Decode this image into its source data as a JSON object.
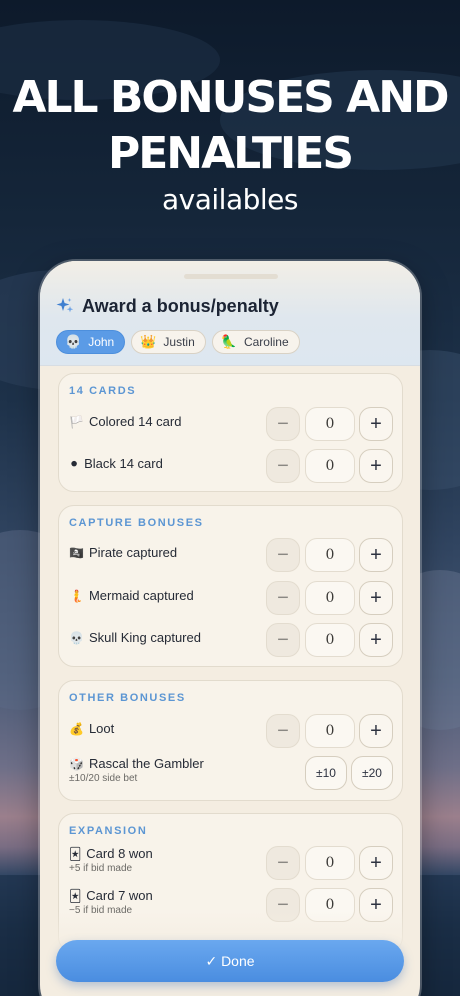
{
  "promo": {
    "headline_line1": "ALL BONUSES AND",
    "headline_line2": "PENALTIES",
    "subtitle": "availables"
  },
  "sheet": {
    "title": "Award a bonus/penalty",
    "players": [
      {
        "emoji": "💀",
        "name": "John",
        "selected": true
      },
      {
        "emoji": "👑",
        "name": "Justin",
        "selected": false
      },
      {
        "emoji": "🦜",
        "name": "Caroline",
        "selected": false
      }
    ],
    "sections": [
      {
        "title": "14 CARDS",
        "rows": [
          {
            "emoji": "🏳️",
            "label": "Colored 14 card",
            "value": "0"
          },
          {
            "emoji": "⚫",
            "label": "Black 14 card",
            "value": "0"
          }
        ]
      },
      {
        "title": "CAPTURE BONUSES",
        "rows": [
          {
            "emoji": "🏴‍☠️",
            "label": "Pirate captured",
            "value": "0"
          },
          {
            "emoji": "🧜",
            "label": "Mermaid captured",
            "value": "0"
          },
          {
            "emoji": "💀",
            "label": "Skull King captured",
            "value": "0"
          }
        ]
      },
      {
        "title": "OTHER BONUSES",
        "rows": [
          {
            "emoji": "💰",
            "label": "Loot",
            "value": "0"
          },
          {
            "emoji": "🎲",
            "label": "Rascal the Gambler",
            "note": "±10/20 side bet",
            "options": [
              "±10",
              "±20"
            ]
          }
        ]
      },
      {
        "title": "EXPANSION",
        "rows": [
          {
            "emoji": "🃏",
            "label": "Card 8 won",
            "note": "+5 if bid made",
            "value": "0"
          },
          {
            "emoji": "🃏",
            "label": "Card 7 won",
            "note": "−5 if bid made",
            "value": "0"
          }
        ]
      }
    ],
    "controls": {
      "minus": "−",
      "plus": "+"
    },
    "done_label": "✓ Done"
  }
}
